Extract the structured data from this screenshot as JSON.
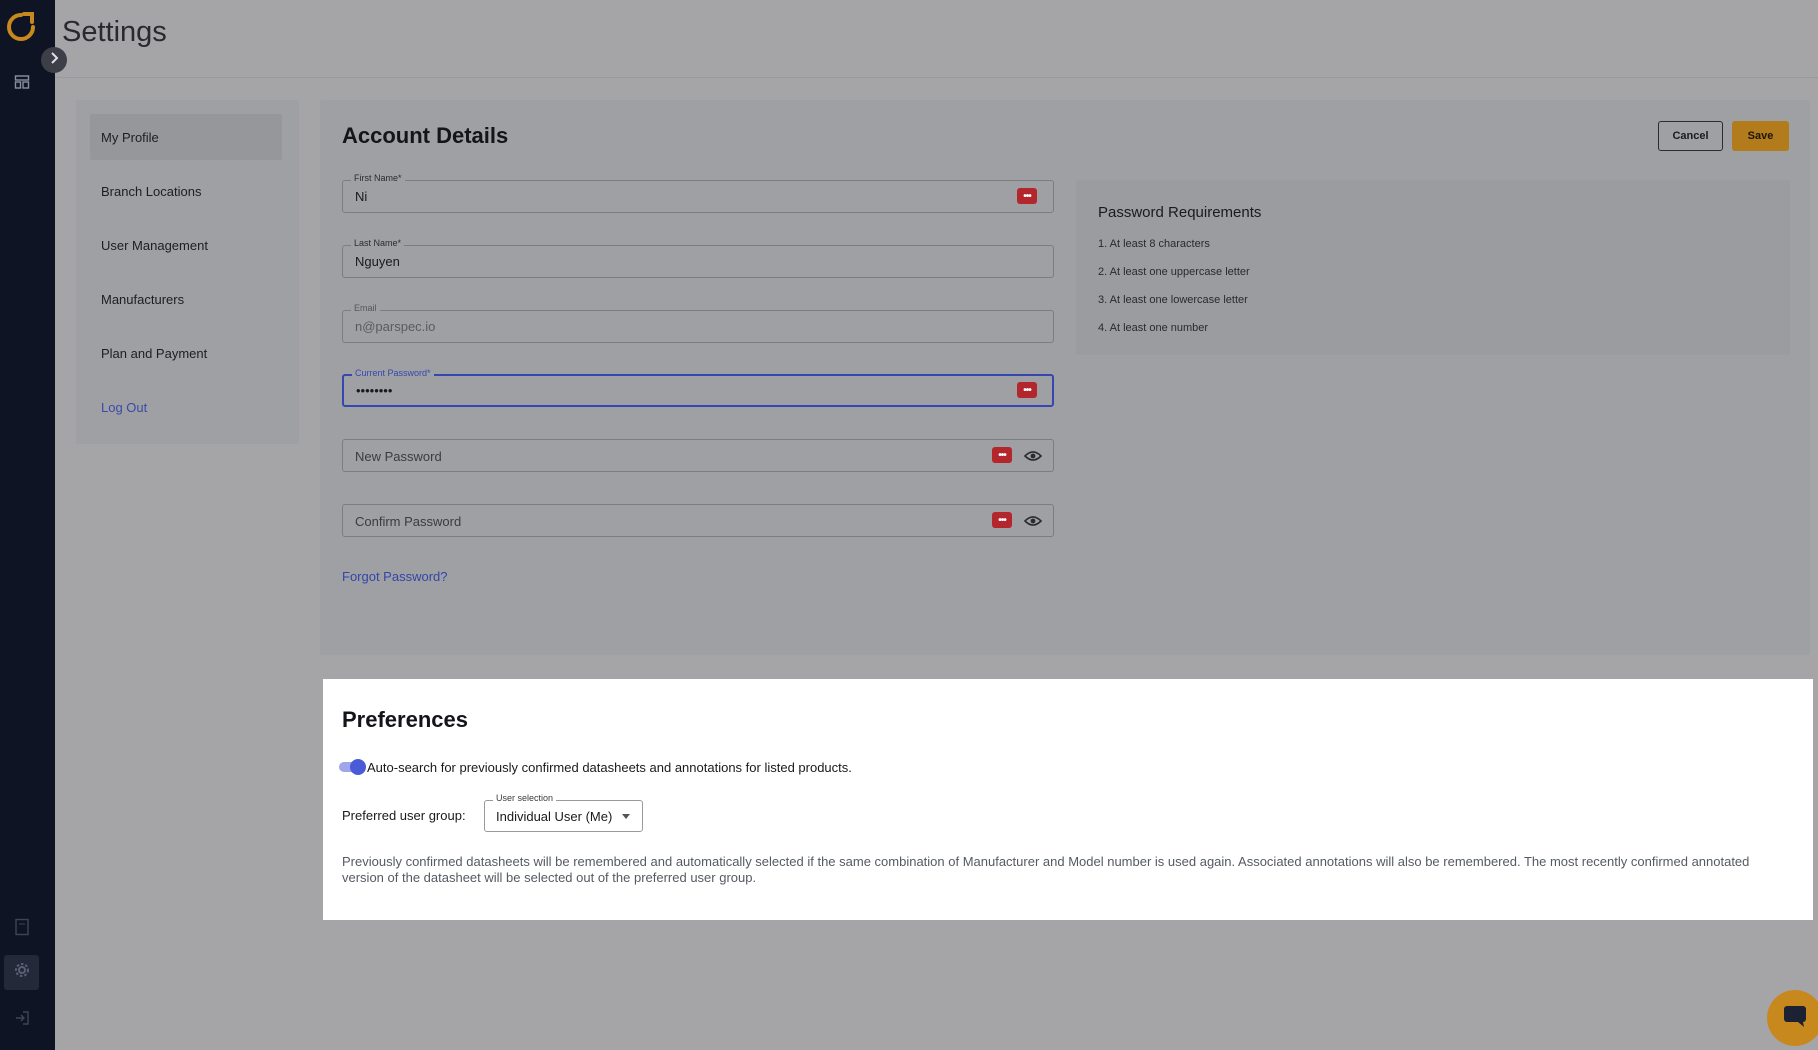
{
  "header": {
    "title": "Settings"
  },
  "rail": {
    "icons": [
      "app-logo",
      "expand-chevron-icon",
      "dashboard-icon",
      "document-icon",
      "gear-icon",
      "logout-icon"
    ]
  },
  "sidebar": {
    "items": [
      {
        "label": "My Profile",
        "active": true
      },
      {
        "label": "Branch Locations"
      },
      {
        "label": "User Management"
      },
      {
        "label": "Manufacturers"
      },
      {
        "label": "Plan and Payment"
      },
      {
        "label": "Log Out"
      }
    ]
  },
  "account": {
    "title": "Account Details",
    "cancel_label": "Cancel",
    "save_label": "Save",
    "first_name": {
      "label": "First Name*",
      "value": "Ni"
    },
    "last_name": {
      "label": "Last Name*",
      "value": "Nguyen"
    },
    "email": {
      "label": "Email",
      "value": "n@parspec.io"
    },
    "current_password": {
      "label": "Current Password*",
      "value": "••••••••"
    },
    "new_password": {
      "placeholder": "New Password"
    },
    "confirm_password": {
      "placeholder": "Confirm Password"
    },
    "forgot_label": "Forgot Password?"
  },
  "requirements": {
    "title": "Password Requirements",
    "items": [
      "1. At least 8 characters",
      "2. At least one uppercase letter",
      "3. At least one lowercase letter",
      "4. At least one number"
    ]
  },
  "preferences": {
    "title": "Preferences",
    "toggle_label": "Auto-search for previously confirmed datasheets and annotations for listed products.",
    "toggle_on": true,
    "group_label": "Preferred user group:",
    "select_label": "User selection",
    "select_value": "Individual User (Me)",
    "description": "Previously confirmed datasheets will be remembered and automatically selected if the same combination of Manufacturer and Model number is used again. Associated annotations will also be remembered. The most recently confirmed annotated version of the datasheet will be selected out of the preferred user group."
  },
  "colors": {
    "accent": "#b27b1c",
    "link": "#3445a8",
    "toggle": "#4a5bd8",
    "rail": "#0f1424"
  }
}
